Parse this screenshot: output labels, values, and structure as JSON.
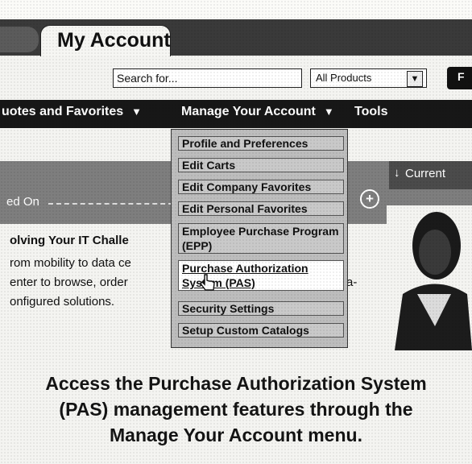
{
  "header": {
    "title": "My Account"
  },
  "search": {
    "placeholder": "Search for...",
    "product_filter": "All Products",
    "go_label": "F"
  },
  "nav": {
    "items": [
      {
        "label": "uotes and Favorites"
      },
      {
        "label": "Manage Your Account"
      },
      {
        "label": "Tools"
      }
    ]
  },
  "dropdown": {
    "items": [
      "Profile and Preferences",
      "Edit Carts",
      "Edit Company Favorites",
      "Edit Personal Favorites",
      "Employee Purchase Program (EPP)",
      "Purchase Authorization System (PAS)",
      "Security Settings",
      "Setup Custom Catalogs"
    ]
  },
  "content": {
    "signed_on": "ed On",
    "current_button": "Current",
    "promo": {
      "title": "olving Your IT Challe",
      "line1": "rom mobility to data ce",
      "line2": "enter to browse, order",
      "line3": "onfigured solutions.",
      "suffix": "a-"
    }
  },
  "caption": {
    "line1": "Access the Purchase Authorization System",
    "line2": "(PAS) management features through the",
    "line3": "Manage Your Account menu."
  }
}
